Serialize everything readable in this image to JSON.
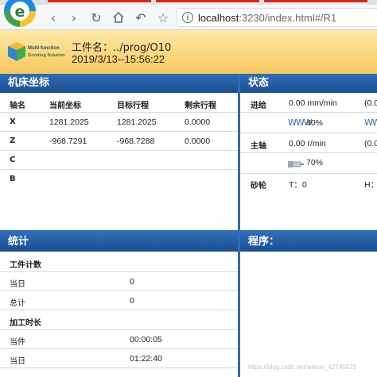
{
  "browser": {
    "address_host": "localhost",
    "address_path": ":3230/index.html#/R1"
  },
  "header": {
    "logo_line1": "Multi-function",
    "logo_line2": "Grinding Solution",
    "file_label": "工件名：../prog/O10",
    "datetime": "2019/3/13--15:56:22"
  },
  "coords": {
    "title": "机床坐标",
    "columns": [
      "轴名",
      "当前坐标",
      "目标行程",
      "剩余行程"
    ],
    "rows": [
      {
        "axis": "X",
        "current": "1281.2025",
        "target": "1281.2025",
        "remaining": "0.0000"
      },
      {
        "axis": "Z",
        "current": "-968.7291",
        "target": "-968.7288",
        "remaining": "0.0000"
      },
      {
        "axis": "C",
        "current": "",
        "target": "",
        "remaining": ""
      },
      {
        "axis": "B",
        "current": "",
        "target": "",
        "remaining": ""
      }
    ]
  },
  "status": {
    "title": "状态",
    "feed_label": "进给",
    "feed_value": "0.00 mm/min",
    "feed_value2": "(0.0",
    "feed_pct": "40%",
    "spindle_label": "主轴",
    "spindle_value": "0.00 r/min",
    "spindle_value2": "(0.0",
    "spindle_pct": "70%",
    "wheel_label": "砂轮",
    "wheel_t": "T：0",
    "wheel_h": "H："
  },
  "stats": {
    "title": "统计",
    "count_section": "工件计数",
    "today_label": "当日",
    "today_value": "0",
    "total_label": "总计",
    "total_value": "0",
    "time_section": "加工时长",
    "current_label": "当件",
    "current_value": "00:00:05",
    "day_label": "当日",
    "day_value": "01:22:40"
  },
  "program": {
    "title": "程序："
  },
  "watermark": "https://blog.csdn.net/weixin_42745673",
  "colors": {
    "panel_blue": "#2f6db5",
    "header_yellow": "#f8c75c"
  }
}
